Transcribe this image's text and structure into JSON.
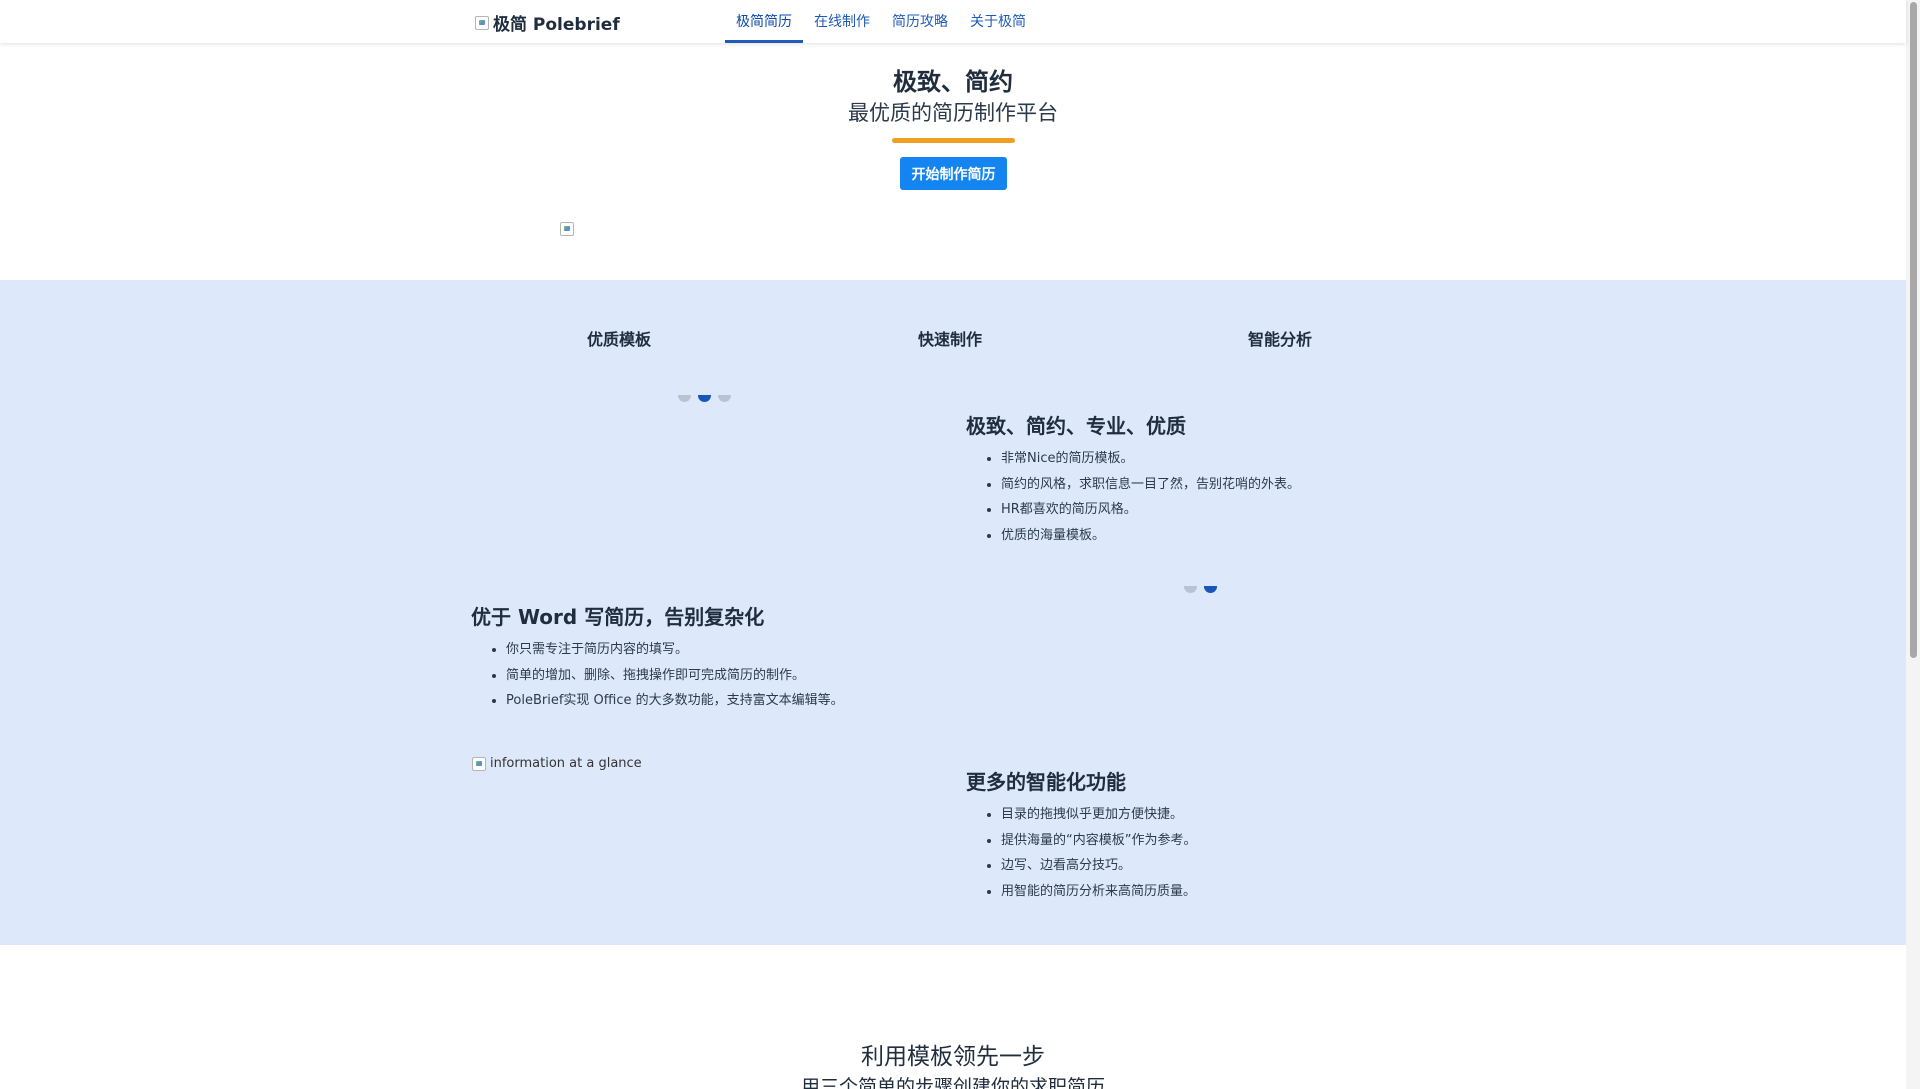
{
  "nav": {
    "brand": "极简 Polebrief",
    "links": [
      "极简简历",
      "在线制作",
      "简历攻略",
      "关于极简"
    ],
    "active_index": 0
  },
  "hero": {
    "title": "极致、简约",
    "subtitle": "最优质的简历制作平台",
    "button": "开始制作简历",
    "accent_color": "#f0a020",
    "button_color": "#1485f0"
  },
  "features": {
    "background": "#dde9fb",
    "tabs": [
      "优质模板",
      "快速制作",
      "智能分析"
    ],
    "blocks": [
      {
        "title": "极致、简约、专业、优质",
        "items": [
          "非常Nice的简历模板。",
          "简约的风格，求职信息一目了然，告别花哨的外表。",
          "HR都喜欢的简历风格。",
          "优质的海量模板。"
        ]
      },
      {
        "title": "优于 Word 写简历，告别复杂化",
        "items": [
          "你只需专注于简历内容的填写。",
          "简单的增加、删除、拖拽操作即可完成简历的制作。",
          "PoleBrief实现 Office 的大多数功能，支持富文本编辑等。"
        ]
      },
      {
        "title": "更多的智能化功能",
        "items": [
          "目录的拖拽似乎更加方便快捷。",
          "提供海量的“内容模板”作为参考。",
          "边写、边看高分技巧。",
          "用智能的简历分析来高简历质量。"
        ]
      }
    ],
    "image_alt": "information at a glance"
  },
  "templates": {
    "title": "利用模板领先一步",
    "subtitle": "用三个简单的步骤创建你的求职简历"
  }
}
